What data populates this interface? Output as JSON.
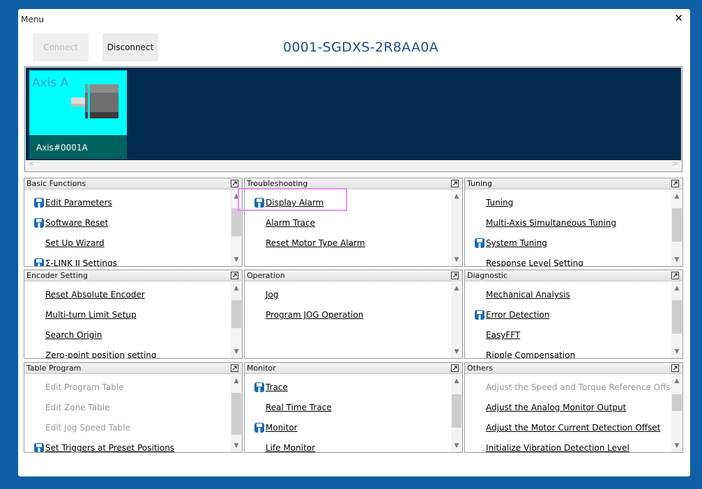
{
  "window": {
    "title": "Menu",
    "close_glyph": "✕",
    "connect_label": "Connect",
    "disconnect_label": "Disconnect",
    "device_title": "0001-SGDXS-2R8AA0A"
  },
  "axis": {
    "card_label": "Axis A",
    "card_name": "Axis#0001A",
    "scroll_left": "<",
    "scroll_right": ">"
  },
  "icons": {
    "panel_expand": "expand-icon",
    "item_icon": "save-disk-icon"
  },
  "colors": {
    "background": "#0e5fa6",
    "axis_area": "#002a4e",
    "axis_card": "#00ffff",
    "axis_card_footer": "#00625f",
    "device_title": "#1f4f86",
    "highlight": "#e38ff0",
    "icon_blue": "#1769b5"
  },
  "panels": [
    {
      "title": "Basic Functions",
      "items": [
        {
          "label": "Edit Parameters",
          "icon": true,
          "disabled": false
        },
        {
          "label": "Software Reset",
          "icon": true,
          "disabled": false
        },
        {
          "label": "Set Up Wizard",
          "icon": false,
          "disabled": false
        },
        {
          "label": "Σ-LINK II Settings",
          "icon": true,
          "disabled": false
        }
      ]
    },
    {
      "title": "Troubleshooting",
      "items": [
        {
          "label": "Display Alarm",
          "icon": true,
          "disabled": false
        },
        {
          "label": "Alarm Trace",
          "icon": false,
          "disabled": false
        },
        {
          "label": "Reset Motor Type Alarm",
          "icon": false,
          "disabled": false
        }
      ]
    },
    {
      "title": "Tuning",
      "items": [
        {
          "label": "Tuning",
          "icon": false,
          "disabled": false
        },
        {
          "label": "Multi-Axis Simultaneous Tuning",
          "icon": false,
          "disabled": false
        },
        {
          "label": "System Tuning",
          "icon": true,
          "disabled": false
        },
        {
          "label": "Response Level Setting",
          "icon": false,
          "disabled": false
        }
      ]
    },
    {
      "title": "Encoder Setting",
      "items": [
        {
          "label": "Reset Absolute Encoder",
          "icon": false,
          "disabled": false
        },
        {
          "label": "Multi-turn Limit Setup",
          "icon": false,
          "disabled": false
        },
        {
          "label": "Search Origin",
          "icon": false,
          "disabled": false
        },
        {
          "label": "Zero-point position setting",
          "icon": false,
          "disabled": false
        }
      ]
    },
    {
      "title": "Operation",
      "items": [
        {
          "label": "Jog",
          "icon": false,
          "disabled": false
        },
        {
          "label": "Program JOG Operation",
          "icon": false,
          "disabled": false
        }
      ]
    },
    {
      "title": "Diagnostic",
      "items": [
        {
          "label": "Mechanical Analysis",
          "icon": false,
          "disabled": false
        },
        {
          "label": "Error Detection",
          "icon": true,
          "disabled": false
        },
        {
          "label": "EasyFFT",
          "icon": false,
          "disabled": false
        },
        {
          "label": "Ripple Compensation",
          "icon": false,
          "disabled": false
        }
      ]
    },
    {
      "title": "Table Program",
      "items": [
        {
          "label": "Edit Program Table",
          "icon": false,
          "disabled": true
        },
        {
          "label": "Edit Zone Table",
          "icon": false,
          "disabled": true
        },
        {
          "label": "Edit Jog Speed Table",
          "icon": false,
          "disabled": true
        },
        {
          "label": "Set Triggers at Preset Positions",
          "icon": true,
          "disabled": false
        }
      ]
    },
    {
      "title": "Monitor",
      "items": [
        {
          "label": "Trace",
          "icon": true,
          "disabled": false
        },
        {
          "label": "Real Time Trace",
          "icon": false,
          "disabled": false
        },
        {
          "label": "Monitor",
          "icon": true,
          "disabled": false
        },
        {
          "label": "Life Monitor",
          "icon": false,
          "disabled": false
        }
      ]
    },
    {
      "title": "Others",
      "items": [
        {
          "label": "Adjust the Speed and Torque Reference Offset",
          "icon": false,
          "disabled": true
        },
        {
          "label": "Adjust the Analog Monitor Output",
          "icon": false,
          "disabled": false
        },
        {
          "label": "Adjust the Motor Current Detection Offset",
          "icon": false,
          "disabled": false
        },
        {
          "label": "Initialize Vibration Detection Level",
          "icon": false,
          "disabled": false
        }
      ]
    }
  ]
}
